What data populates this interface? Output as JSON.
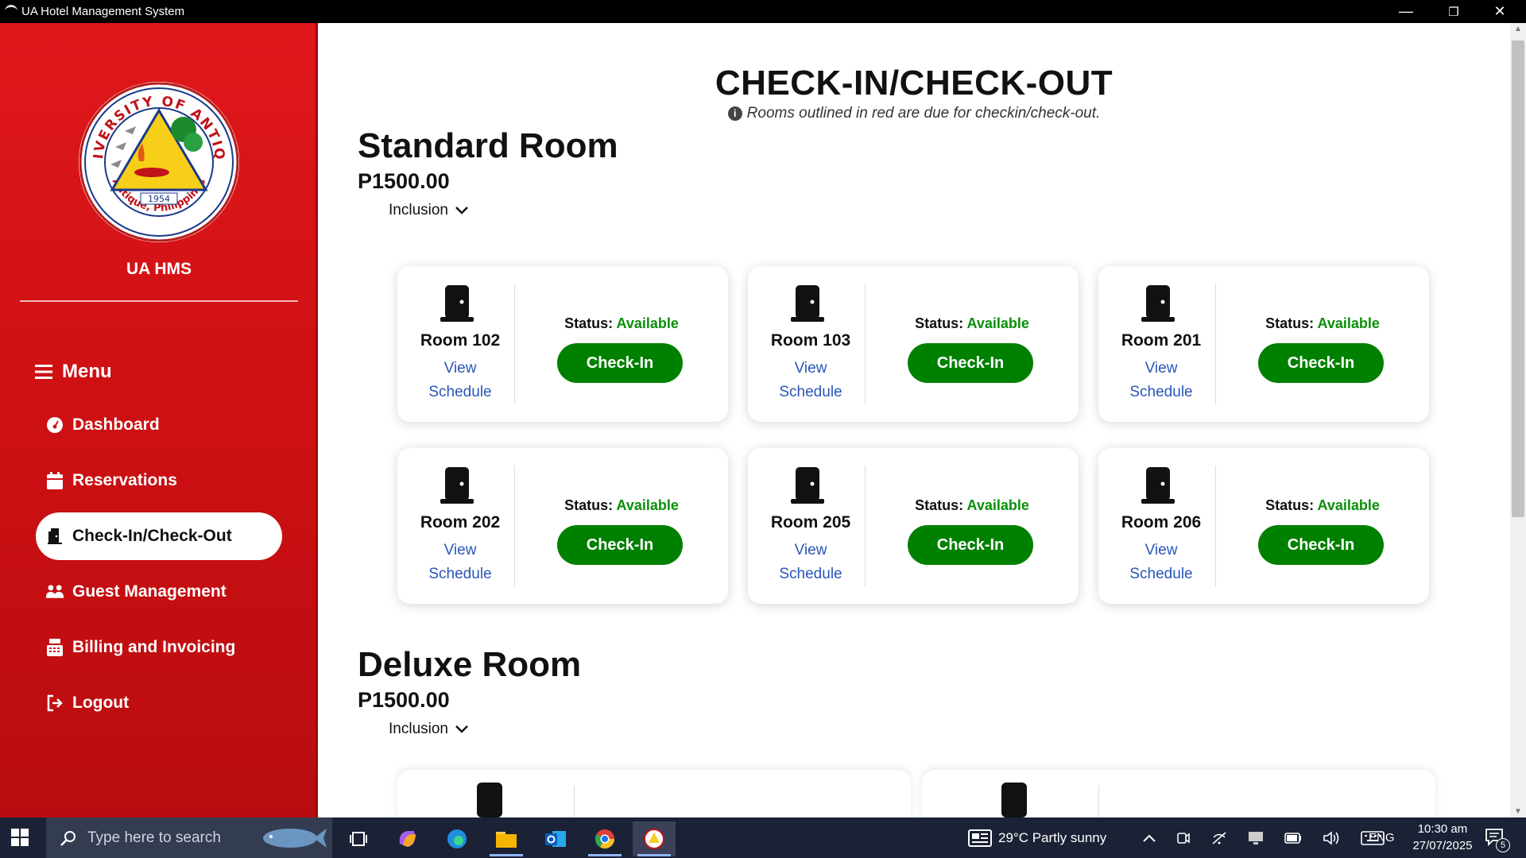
{
  "window": {
    "title": "UA Hotel Management System",
    "minimize": "—",
    "restore": "❐",
    "close": "✕"
  },
  "sidebar": {
    "brand": "UA HMS",
    "menu_label": "Menu",
    "items": [
      {
        "label": "Dashboard",
        "icon": "dashboard-icon"
      },
      {
        "label": "Reservations",
        "icon": "calendar-icon"
      },
      {
        "label": "Check-In/Check-Out",
        "icon": "door-icon",
        "active": true
      },
      {
        "label": "Guest Management",
        "icon": "users-icon"
      },
      {
        "label": "Billing and Invoicing",
        "icon": "cash-register-icon"
      },
      {
        "label": "Logout",
        "icon": "logout-icon"
      }
    ],
    "logo": {
      "top_text": "UNIVERSITY OF ANTIQUE",
      "bottom_text": "Antique, Philippines",
      "year": "1954"
    }
  },
  "main": {
    "title": "CHECK-IN/CHECK-OUT",
    "note": "Rooms outlined in red are due for checkin/check-out.",
    "sections": [
      {
        "title": "Standard Room",
        "price": "P1500.00",
        "inclusion_label": "Inclusion",
        "rooms": [
          {
            "name": "Room 102",
            "status_label": "Status:",
            "status": "Available",
            "schedule_line1": "View",
            "schedule_line2": "Schedule",
            "action": "Check-In"
          },
          {
            "name": "Room 103",
            "status_label": "Status:",
            "status": "Available",
            "schedule_line1": "View",
            "schedule_line2": "Schedule",
            "action": "Check-In"
          },
          {
            "name": "Room 201",
            "status_label": "Status:",
            "status": "Available",
            "schedule_line1": "View",
            "schedule_line2": "Schedule",
            "action": "Check-In"
          },
          {
            "name": "Room 202",
            "status_label": "Status:",
            "status": "Available",
            "schedule_line1": "View",
            "schedule_line2": "Schedule",
            "action": "Check-In"
          },
          {
            "name": "Room 205",
            "status_label": "Status:",
            "status": "Available",
            "schedule_line1": "View",
            "schedule_line2": "Schedule",
            "action": "Check-In"
          },
          {
            "name": "Room 206",
            "status_label": "Status:",
            "status": "Available",
            "schedule_line1": "View",
            "schedule_line2": "Schedule",
            "action": "Check-In"
          }
        ]
      },
      {
        "title": "Deluxe Room",
        "price": "P1500.00",
        "inclusion_label": "Inclusion"
      }
    ]
  },
  "taskbar": {
    "search_placeholder": "Type here to search",
    "weather": "29°C  Partly sunny",
    "language": "ENG",
    "time": "10:30 am",
    "date": "27/07/2025",
    "notification_count": "5"
  },
  "colors": {
    "sidebar_red": "#d4151a",
    "available_green": "#0a8f0a",
    "button_green": "#008000",
    "link_blue": "#2a55b8"
  }
}
